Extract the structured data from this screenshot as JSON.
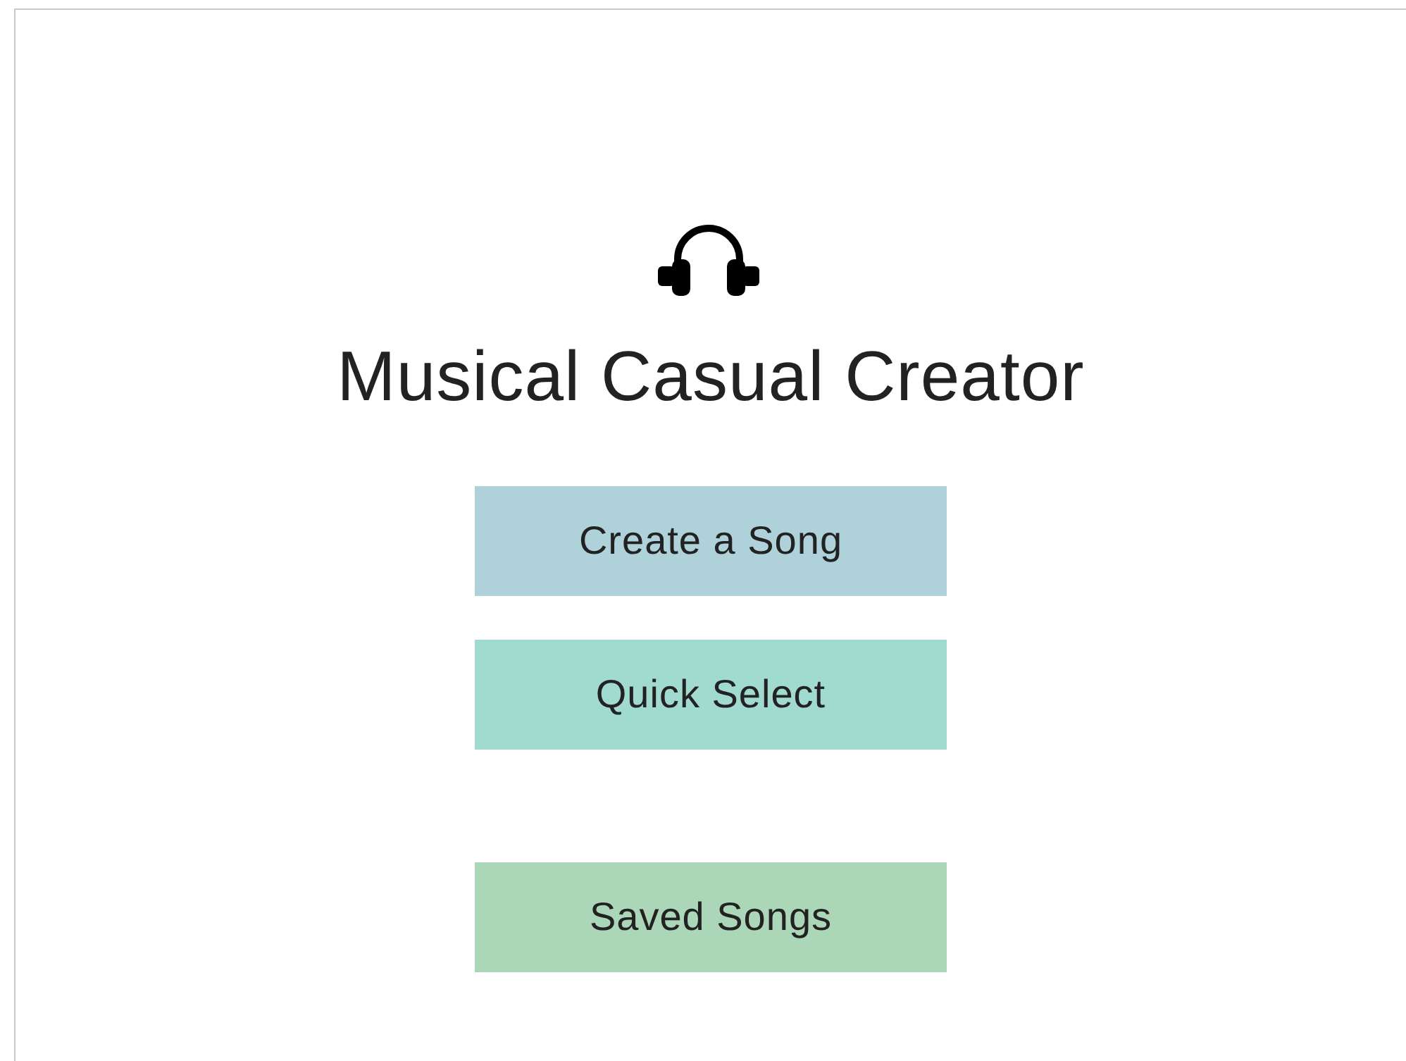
{
  "title": "Musical Casual Creator",
  "buttons": [
    {
      "label": "Create a Song",
      "color": "#afd2da"
    },
    {
      "label": "Quick Select",
      "color": "#a1dbd0"
    },
    {
      "label": "Saved Songs",
      "color": "#acd6b8"
    }
  ]
}
